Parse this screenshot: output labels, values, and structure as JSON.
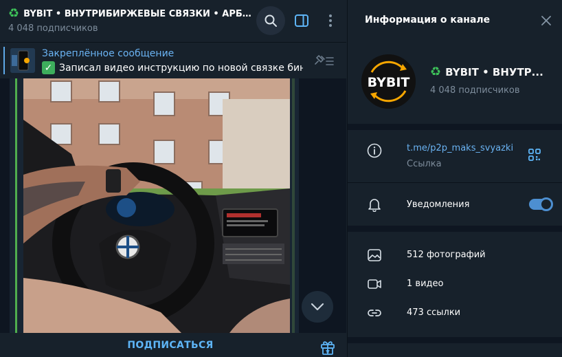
{
  "chat": {
    "title": "BYBIT • ВНУТРИБИРЖЕВЫЕ СВЯЗКИ • АРБИТР...",
    "subscribers": "4 048 подписчиков",
    "pinned": {
      "label": "Закреплённое сообщение",
      "text": "Записал видео инструкцию по новой связке бин..."
    },
    "subscribe_label": "ПОДПИСАТЬСЯ"
  },
  "info": {
    "title": "Информация о канале",
    "channel_name": "BYBIT • ВНУТР...",
    "subscribers": "4 048 подписчиков",
    "avatar_text": "BYBIT",
    "link": "t.me/p2p_maks_svyazki",
    "link_label": "Ссылка",
    "notifications_label": "Уведомления",
    "notifications_on": true,
    "media": [
      {
        "icon": "photo-icon",
        "label": "512 фотографий"
      },
      {
        "icon": "video-icon",
        "label": "1 видео"
      },
      {
        "icon": "link-icon",
        "label": "473 ссылки"
      }
    ]
  },
  "colors": {
    "accent": "#6ab3f3",
    "background": "#17212b",
    "chat_background": "#0e1621",
    "recycle_green": "#3ec45a",
    "avatar_orange": "#f7a600"
  }
}
